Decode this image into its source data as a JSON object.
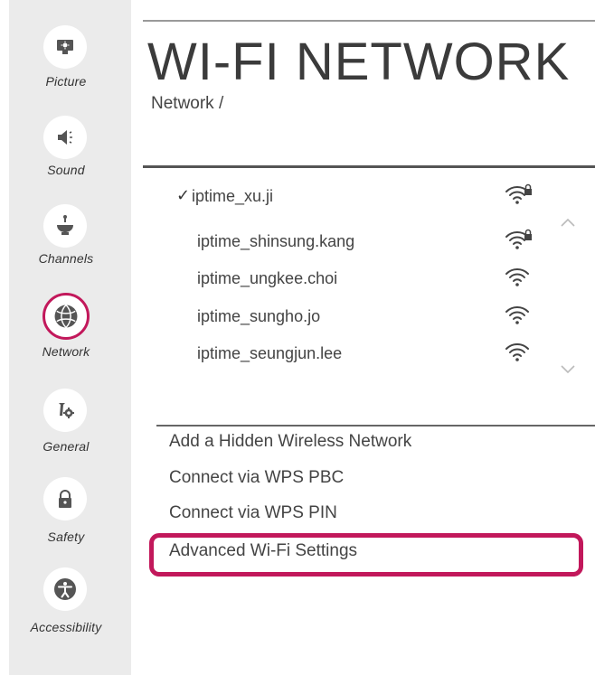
{
  "sidebar": {
    "items": [
      {
        "label": "Picture",
        "icon": "picture-icon"
      },
      {
        "label": "Sound",
        "icon": "speaker-icon"
      },
      {
        "label": "Channels",
        "icon": "antenna-icon"
      },
      {
        "label": "Network",
        "icon": "globe-icon",
        "active": true
      },
      {
        "label": "General",
        "icon": "tools-icon"
      },
      {
        "label": "Safety",
        "icon": "lock-icon"
      },
      {
        "label": "Accessibility",
        "icon": "accessibility-icon"
      }
    ]
  },
  "header": {
    "title": "WI-FI NETWORK",
    "breadcrumb": "Network /"
  },
  "networks": [
    {
      "name": "iptime_xu.ji",
      "connected": true,
      "secured": true,
      "signal_icon": "wifi-lock-icon"
    },
    {
      "name": "iptime_shinsung.kang",
      "connected": false,
      "secured": true,
      "signal_icon": "wifi-lock-icon"
    },
    {
      "name": "iptime_ungkee.choi",
      "connected": false,
      "secured": false,
      "signal_icon": "wifi-icon"
    },
    {
      "name": "iptime_sungho.jo",
      "connected": false,
      "secured": false,
      "signal_icon": "wifi-icon"
    },
    {
      "name": "iptime_seungjun.lee",
      "connected": false,
      "secured": false,
      "signal_icon": "wifi-icon"
    }
  ],
  "connected_mark": "✓",
  "options": [
    {
      "label": "Add a Hidden Wireless Network"
    },
    {
      "label": "Connect via WPS PBC"
    },
    {
      "label": "Connect via WPS PIN"
    },
    {
      "label": "Advanced Wi-Fi Settings",
      "highlighted": true
    }
  ],
  "colors": {
    "accent": "#c2185b",
    "sidebar_bg": "#ebebeb",
    "text": "#444444"
  }
}
